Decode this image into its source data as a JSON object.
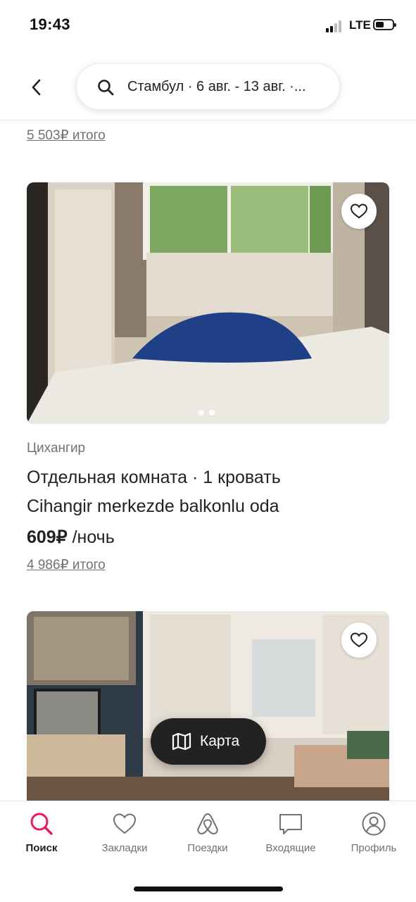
{
  "status_bar": {
    "time": "19:43",
    "network": "LTE"
  },
  "search": {
    "query_summary": "Стамбул · 6 авг. - 13 авг. ·..."
  },
  "listings": [
    {
      "total": "5 503₽ итого"
    },
    {
      "neighborhood": "Цихангир",
      "room_type": "Отдельная комната · 1 кровать",
      "title": "Cihangir merkezde balkonlu oda",
      "price": "609₽",
      "price_unit": " /ночь",
      "total": "4 986₽ итого",
      "photo_count": 2
    },
    {}
  ],
  "map_button": {
    "label": "Карта"
  },
  "tabs": [
    {
      "label": "Поиск",
      "icon": "search-icon",
      "active": true
    },
    {
      "label": "Закладки",
      "icon": "heart-icon"
    },
    {
      "label": "Поездки",
      "icon": "airbnb-icon"
    },
    {
      "label": "Входящие",
      "icon": "message-icon"
    },
    {
      "label": "Профиль",
      "icon": "profile-icon"
    }
  ],
  "colors": {
    "accent": "#E31C5F",
    "text": "#222222",
    "muted": "#717171"
  }
}
